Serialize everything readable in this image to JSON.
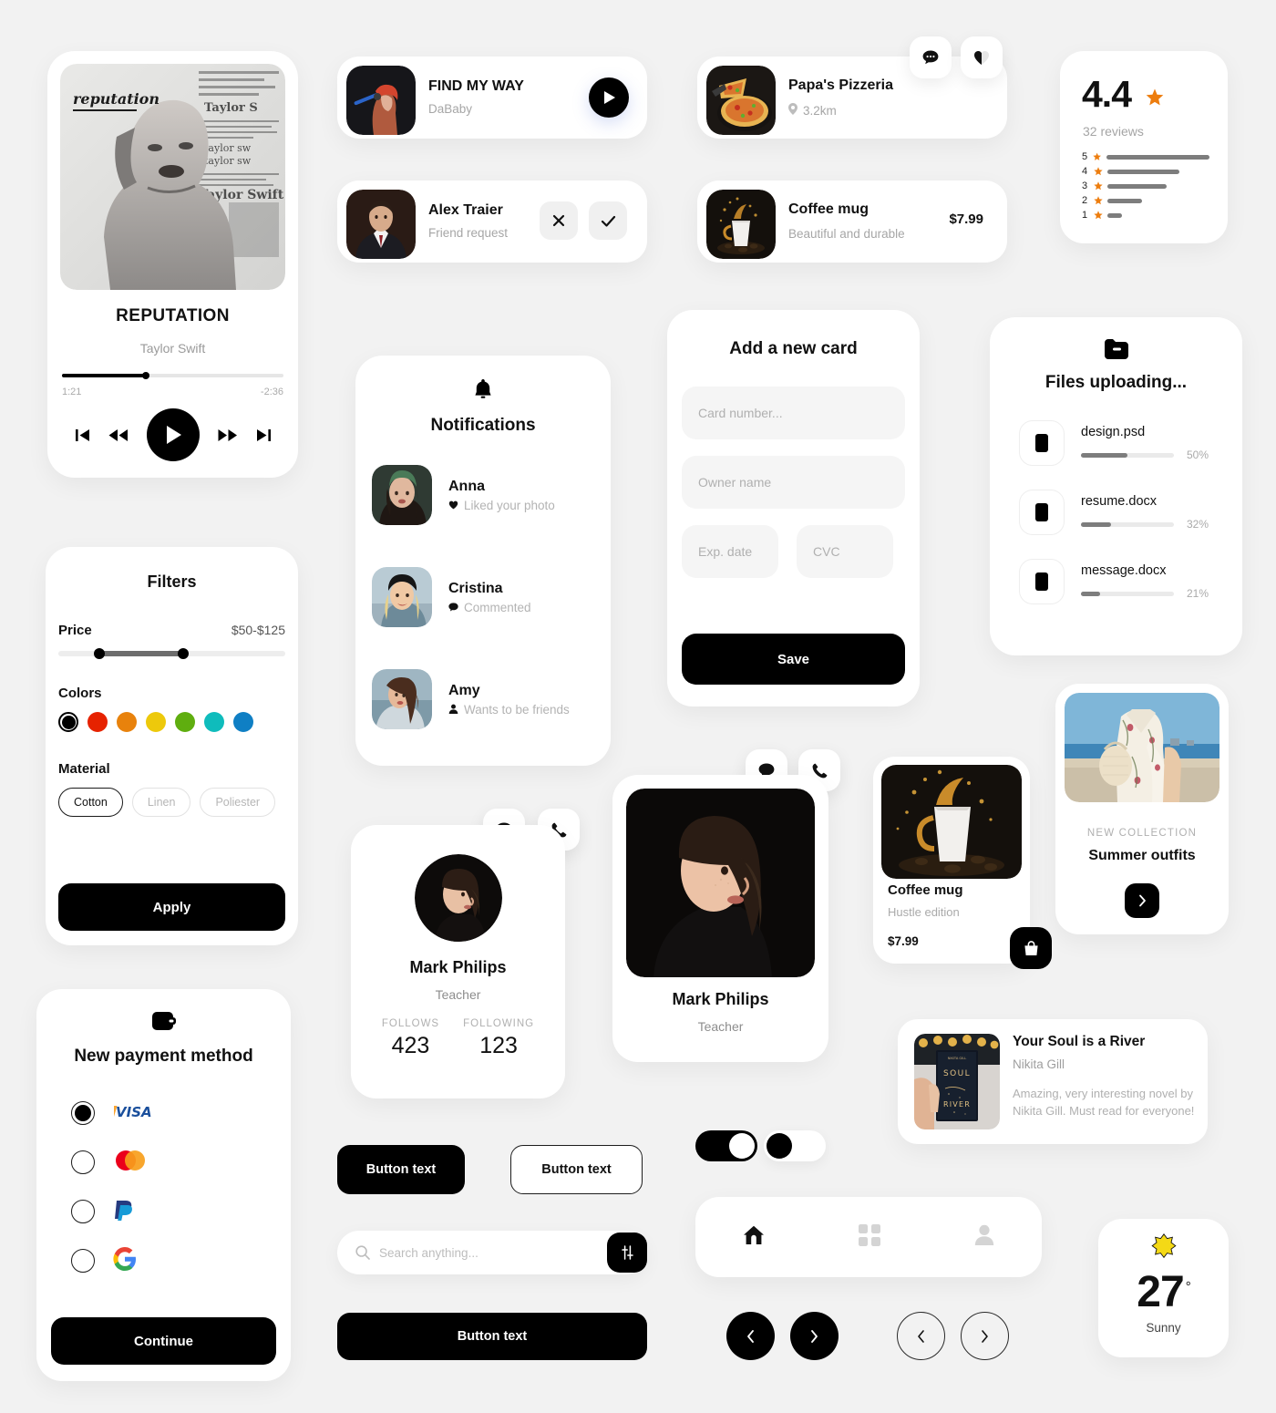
{
  "music_player": {
    "album_title": "REPUTATION",
    "artist": "Taylor Swift",
    "album_art_label": "reputation",
    "time_elapsed": "1:21",
    "time_remaining": "-2:36",
    "progress_percent": 38,
    "controls": [
      "skip-start",
      "rewind",
      "play",
      "fast-forward",
      "skip-end"
    ]
  },
  "song_row": {
    "title": "FIND MY WAY",
    "artist": "DaBaby",
    "play_label": "play"
  },
  "friend_request": {
    "name": "Alex Traier",
    "subtitle": "Friend request",
    "decline_label": "decline",
    "accept_label": "accept"
  },
  "restaurant": {
    "name": "Papa's Pizzeria",
    "distance": "3.2km"
  },
  "product_row": {
    "name": "Coffee mug",
    "subtitle": "Beautiful and durable",
    "price": "$7.99"
  },
  "rating": {
    "score": "4.4",
    "reviews": "32 reviews",
    "breakdown": [
      {
        "stars": "5",
        "percent": 100
      },
      {
        "stars": "4",
        "percent": 65
      },
      {
        "stars": "3",
        "percent": 53
      },
      {
        "stars": "2",
        "percent": 31
      },
      {
        "stars": "1",
        "percent": 13
      }
    ],
    "star_color": "#ED7D0E"
  },
  "filters": {
    "title": "Filters",
    "price_label": "Price",
    "price_value": "$50-$125",
    "slider": {
      "low_percent": 18,
      "high_percent": 55
    },
    "colors_label": "Colors",
    "colors": [
      {
        "name": "black",
        "hex": "#000000",
        "selected": true
      },
      {
        "name": "red",
        "hex": "#E62200",
        "selected": false
      },
      {
        "name": "orange",
        "hex": "#E8820C",
        "selected": false
      },
      {
        "name": "yellow",
        "hex": "#EDC90B",
        "selected": false
      },
      {
        "name": "green",
        "hex": "#5FAE0F",
        "selected": false
      },
      {
        "name": "teal",
        "hex": "#0FBCBC",
        "selected": false
      },
      {
        "name": "blue",
        "hex": "#0F7FC4",
        "selected": false
      }
    ],
    "material_label": "Material",
    "materials": [
      {
        "label": "Cotton",
        "selected": true
      },
      {
        "label": "Linen",
        "selected": false
      },
      {
        "label": "Poliester",
        "selected": false
      }
    ],
    "apply_label": "Apply"
  },
  "payment": {
    "title": "New payment method",
    "methods": [
      {
        "name": "Visa",
        "selected": true
      },
      {
        "name": "Mastercard",
        "selected": false
      },
      {
        "name": "PayPal",
        "selected": false
      },
      {
        "name": "Google Pay",
        "selected": false
      }
    ],
    "continue_label": "Continue"
  },
  "notifications": {
    "title": "Notifications",
    "items": [
      {
        "name": "Anna",
        "action": "Liked your photo",
        "icon": "heart-icon"
      },
      {
        "name": "Cristina",
        "action": "Commented",
        "icon": "comment-icon"
      },
      {
        "name": "Amy",
        "action": "Wants to be friends",
        "icon": "person-icon"
      }
    ]
  },
  "add_card": {
    "title": "Add a new card",
    "card_number_placeholder": "Card number...",
    "owner_name_placeholder": "Owner name",
    "exp_date_placeholder": "Exp. date",
    "cvc_placeholder": "CVC",
    "card_number_value": "",
    "owner_name_value": "",
    "exp_date_value": "",
    "cvc_value": "",
    "save_label": "Save"
  },
  "files": {
    "title": "Files uploading...",
    "items": [
      {
        "name": "design.psd",
        "percent_label": "50%",
        "percent": 50
      },
      {
        "name": "resume.docx",
        "percent_label": "32%",
        "percent": 32
      },
      {
        "name": "message.docx",
        "percent_label": "21%",
        "percent": 21
      }
    ]
  },
  "profile_small": {
    "name": "Mark Philips",
    "role": "Teacher",
    "follows_label": "FOLLOWS",
    "follows_value": "423",
    "following_label": "FOLLOWING",
    "following_value": "123"
  },
  "profile_large": {
    "name": "Mark Philips",
    "role": "Teacher"
  },
  "product_card": {
    "name": "Coffee mug",
    "subtitle": "Hustle edition",
    "price": "$7.99"
  },
  "collection": {
    "tag": "NEW COLLECTION",
    "title": "Summer outfits"
  },
  "book": {
    "title": "Your Soul is a River",
    "author": "Nikita Gill",
    "description": "Amazing, very interesting novel by Nikita Gill. Must read for everyone!",
    "cover_lines": [
      "SOUL",
      "RIVER"
    ]
  },
  "buttons": {
    "primary_label": "Button text",
    "secondary_label": "Button text",
    "wide_label": "Button text"
  },
  "search": {
    "placeholder": "Search anything...",
    "value": ""
  },
  "toggles": [
    {
      "name": "toggle-on",
      "state": "on"
    },
    {
      "name": "toggle-off",
      "state": "off"
    }
  ],
  "bottom_nav": {
    "items": [
      {
        "name": "home",
        "active": true
      },
      {
        "name": "grid",
        "active": false
      },
      {
        "name": "profile",
        "active": false
      }
    ]
  },
  "pagination": {
    "prev_label": "previous",
    "next_label": "next"
  },
  "weather": {
    "temperature": "27",
    "degree_symbol": "°",
    "condition": "Sunny",
    "icon": "sun-icon",
    "sun_color": "#F4D916"
  }
}
